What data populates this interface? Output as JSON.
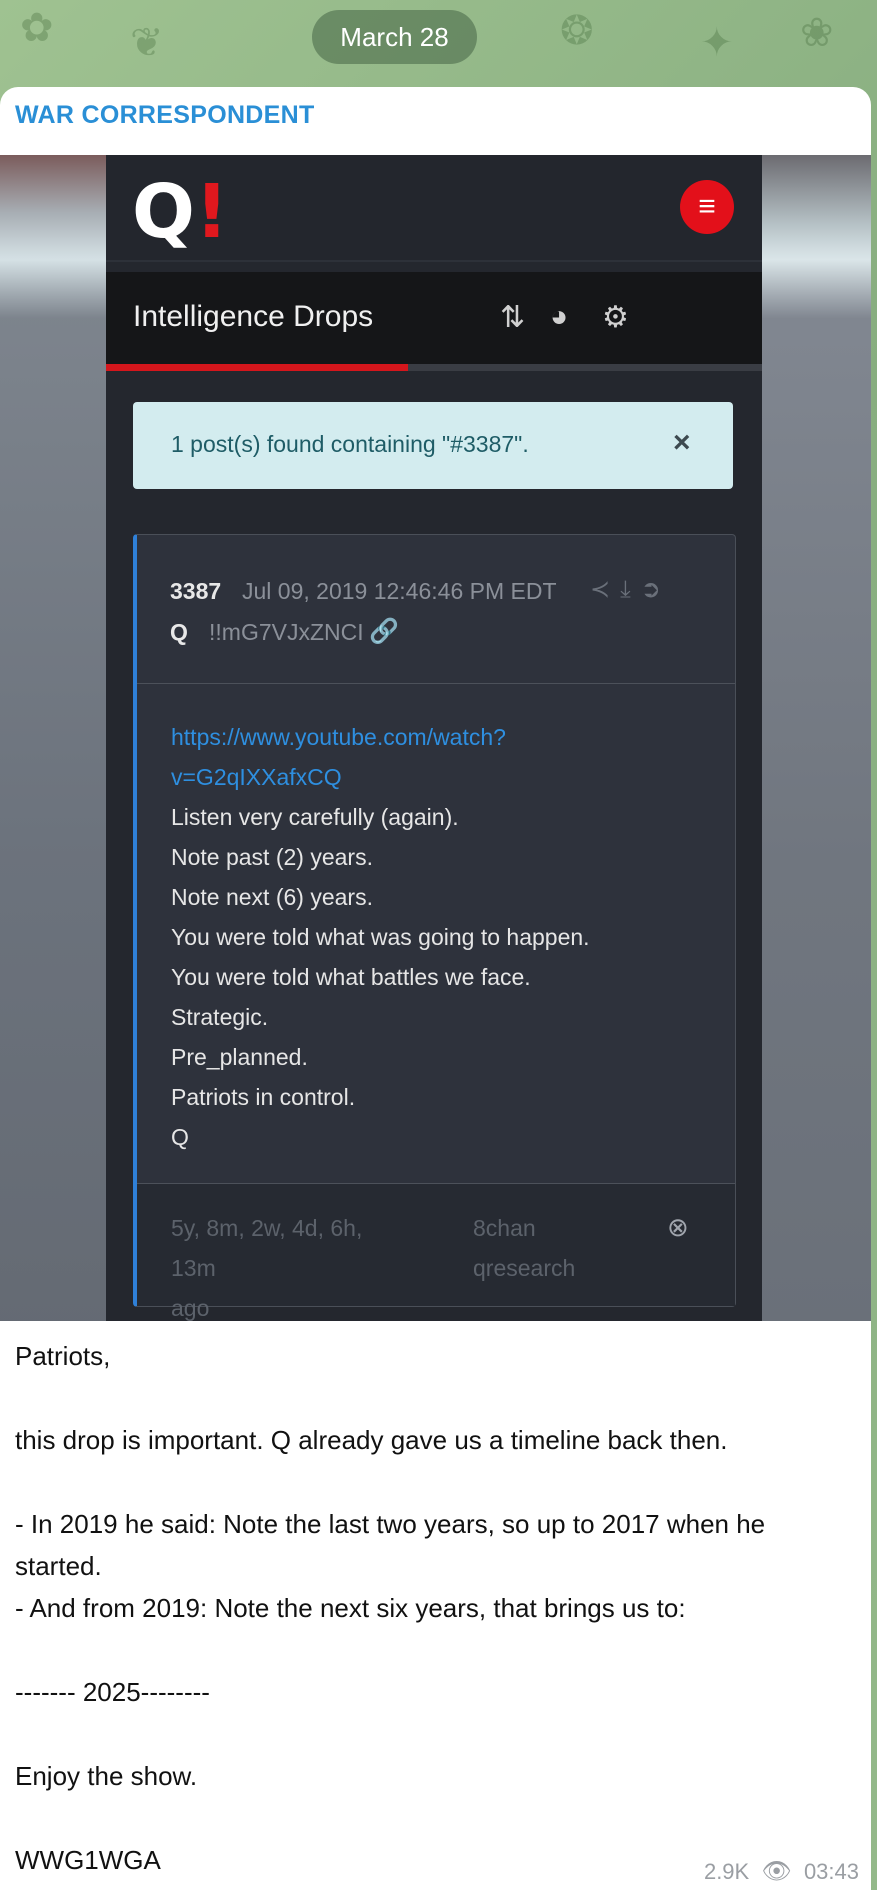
{
  "date_pill": "March 28",
  "message": {
    "channel_name": "WAR CORRESPONDENT",
    "screenshot": {
      "logo": {
        "letter": "Q",
        "mark": "!"
      },
      "menu_icon": "hamburger-menu-icon",
      "title": "Intelligence Drops",
      "toolbar_icons": [
        "sort-icon",
        "palette-icon",
        "gears-icon"
      ],
      "progress_fraction": 0.46,
      "alert_text": "1 post(s) found containing \"#3387\".",
      "alert_close": "×",
      "post": {
        "number": "3387",
        "date": "Jul 09, 2019 12:46:46 PM EDT",
        "author": "Q",
        "tripcode": "!!mG7VJxZNCI",
        "header_icons": [
          "share-icon",
          "download-icon",
          "arrow-circle-right-icon"
        ],
        "link_icon": "link-icon",
        "url_line1": "https://www.youtube.com/watch?",
        "url_line2": "v=G2qIXXafxCQ",
        "lines": [
          "Listen very carefully (again).",
          "Note past (2) years.",
          "Note next (6) years.",
          "You were told what was going to happen.",
          "You were told what battles we face.",
          "Strategic.",
          "Pre_planned.",
          "Patriots in control.",
          "Q"
        ],
        "age_line1": "5y, 8m, 2w, 4d, 6h, 13m",
        "age_line2": "ago",
        "source_line1": "8chan",
        "source_line2": "qresearch"
      }
    },
    "caption": [
      "Patriots,",
      "",
      "this drop is important. Q already gave us a timeline back then.",
      "",
      "- In 2019 he said: Note the last two years, so up to 2017 when he",
      "started.",
      "- And from 2019: Note the next six years, that brings us to:",
      "",
      "------- 2025--------",
      "",
      "Enjoy the show.",
      "",
      "WWG1WGA"
    ],
    "views": "2.9K",
    "time": "03:43"
  }
}
